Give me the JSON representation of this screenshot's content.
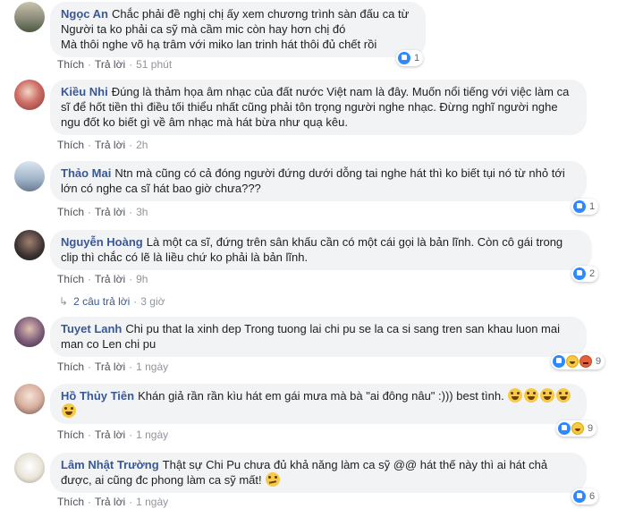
{
  "comments": [
    {
      "author": "Ngọc An",
      "text": "Chắc phải đề nghị chị ấy xem chương trình sàn đấu ca từ\nNgười ta ko phải ca sỹ mà cầm mic còn hay hơn chị đó\nMà thôi nghe võ hạ trâm với miko lan trinh hát thôi đủ chết rồi",
      "like_label": "Thích",
      "reply_label": "Trả lời",
      "time": "51 phút",
      "reaction_count": "1",
      "avatar_color": "#8c8a7a"
    },
    {
      "author": "Kiều Nhi",
      "text": "Đúng là thảm họa âm nhạc của đất nước Việt nam là đây. Muốn nổi tiếng với việc làm ca sĩ để hốt tiền thì điều tối thiểu nhất cũng phải tôn trọng người nghe nhạc. Đừng nghĩ người nghe ngu đốt ko biết gì về âm nhạc mà hát bừa như quạ kêu.",
      "like_label": "Thích",
      "reply_label": "Trả lời",
      "time": "2h",
      "avatar_color": "#c0605a"
    },
    {
      "author": "Thảo Mai",
      "text": "Ntn mà cũng có cả đóng người đứng dưới dỗng tai nghe hát thì ko biết tụi nó từ nhỏ tới lớn có nghe ca sĩ hát bao giờ chưa???",
      "like_label": "Thích",
      "reply_label": "Trả lời",
      "time": "3h",
      "reaction_count": "1",
      "avatar_color": "#9fb3c8"
    },
    {
      "author": "Nguyễn Hoàng",
      "text": "Là một ca sĩ, đứng trên sân khấu cần có một cái gọi là bản lĩnh. Còn cô gái trong clip thì chắc có lẽ là liều chứ ko phải là bản lĩnh.",
      "like_label": "Thích",
      "reply_label": "Trả lời",
      "time": "9h",
      "reaction_count": "2",
      "replies_label": "2 câu trả lời",
      "replies_time": "3 giờ",
      "avatar_color": "#3a3030"
    },
    {
      "author": "Tuyet Lanh",
      "text": "Chi pu that la xinh dep Trong tuong lai chi pu se la ca si sang tren san khau luon mai man co Len chi pu",
      "like_label": "Thích",
      "reply_label": "Trả lời",
      "time": "1 ngày",
      "reaction_count": "9",
      "avatar_color": "#7d5c7a"
    },
    {
      "author": "Hồ Thủy Tiên",
      "text": "Khán giả rần rần kìu hát em gái mưa mà bà \"ai đông nâu\" :))) best tình.",
      "like_label": "Thích",
      "reply_label": "Trả lời",
      "time": "1 ngày",
      "reaction_count": "9",
      "avatar_color": "#d8b0a0"
    },
    {
      "author": "Lâm Nhật Trường",
      "text": "Thật sự Chi Pu chưa đủ khả năng làm ca sỹ @@ hát thế này thì ai hát chả được, ai cũng đc phong làm ca sỹ mất!",
      "like_label": "Thích",
      "reply_label": "Trả lời",
      "time": "1 ngày",
      "reaction_count": "6",
      "avatar_color": "#e8e4d8"
    }
  ],
  "icons": {
    "like": "like-icon",
    "haha": "haha-icon",
    "angry": "angry-icon",
    "laugh_emoji": "laughing-emoji-icon",
    "confused_emoji": "confused-emoji-icon"
  },
  "colors": {
    "author": "#385898",
    "bubble": "#f2f3f5",
    "meta": "#90949c"
  }
}
